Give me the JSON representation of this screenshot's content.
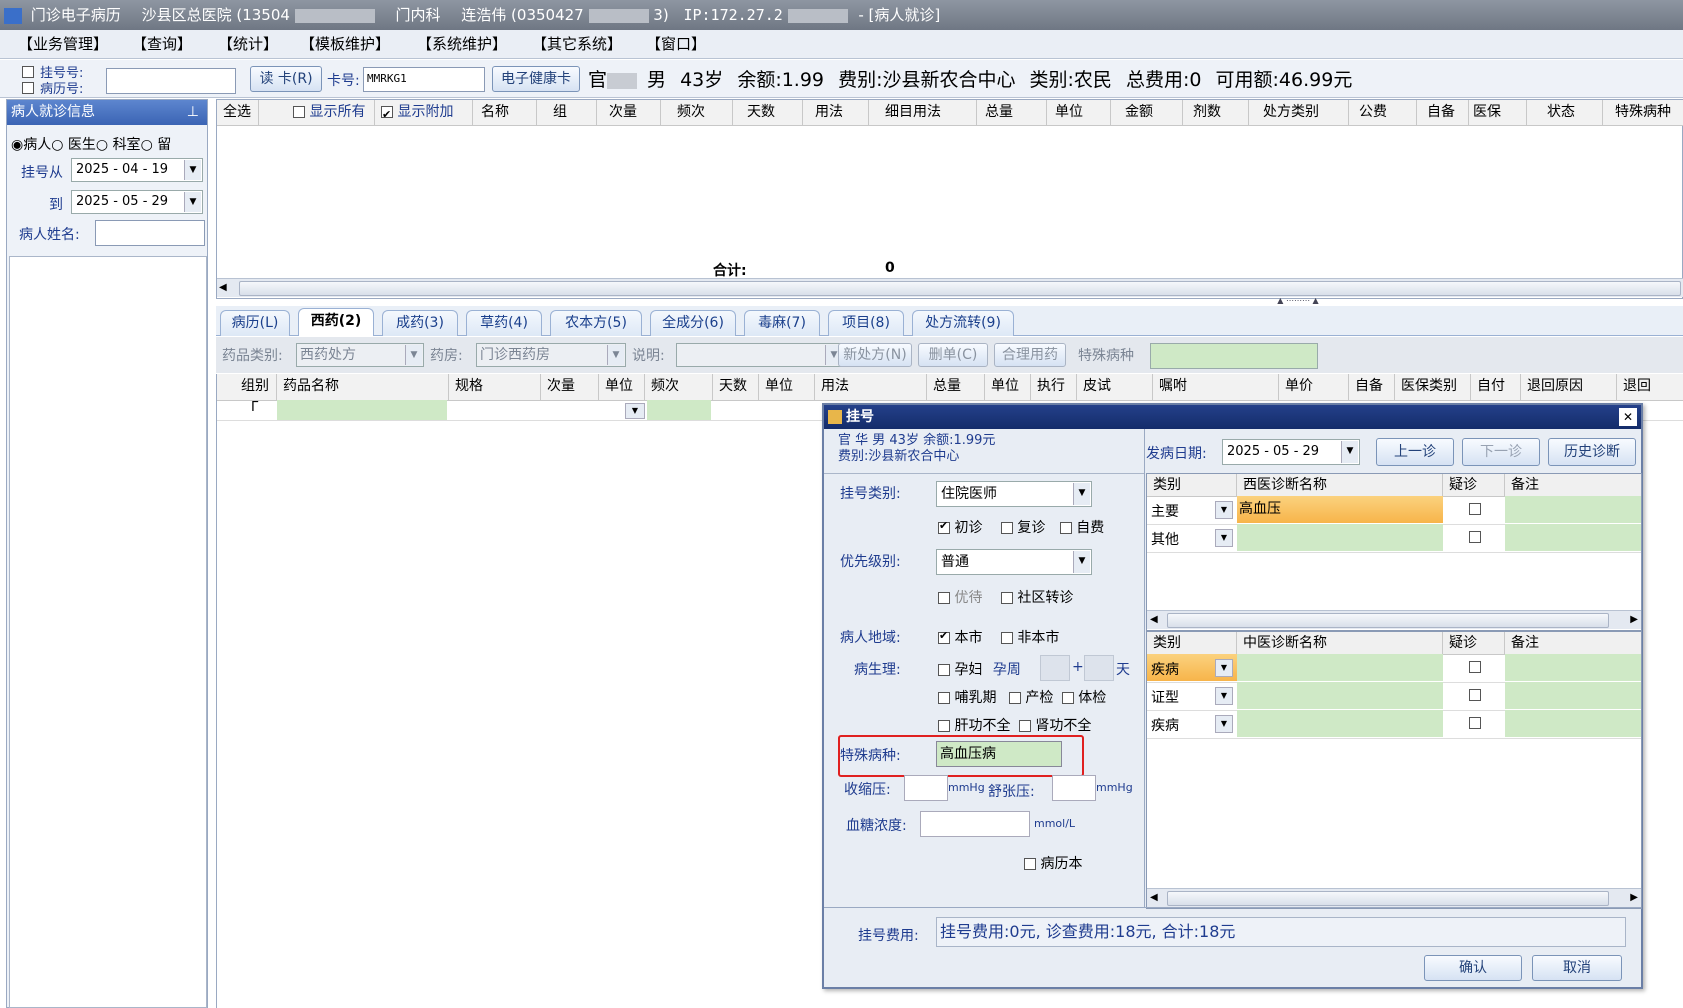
{
  "titlebar": {
    "app": "门诊电子病历",
    "hospital": "沙县区总医院 (13504",
    "dept": "门内科",
    "doctor": "连浩伟 (0350427",
    "doctor_tail": "3)",
    "ip": "IP:172.27.2",
    "window": "- [病人就诊]"
  },
  "menu": [
    "【业务管理】",
    "【查询】",
    "【统计】",
    "【模板维护】",
    "【系统维护】",
    "【其它系统】",
    "【窗口】"
  ],
  "toolbar": {
    "reg_no_label": "挂号号:",
    "record_no_label": "病历号:",
    "read_card": "读 卡(R)",
    "card_no_label": "卡号:",
    "card_no_value": "MMRKG1",
    "health_card": "电子健康卡",
    "patient_info": "官",
    "patient_gender": "男",
    "patient_age": "43岁",
    "balance": "余额:1.99",
    "fee_type": "费别:沙县新农合中心",
    "category": "类别:农民",
    "total_fee": "总费用:0",
    "available": "可用额:46.99元"
  },
  "left_panel": {
    "title": "病人就诊信息",
    "pin": "ꟸ",
    "radios": [
      "病人",
      "医生",
      "科室",
      "留"
    ],
    "from_label": "挂号从",
    "from_date": "2025 - 04 - 19",
    "to_label": "到",
    "to_date": "2025 - 05 - 29",
    "name_label": "病人姓名:"
  },
  "top_grid": {
    "headers": [
      "全选",
      "显示所有",
      "显示附加",
      "名称",
      "组",
      "次量",
      "频次",
      "天数",
      "用法",
      "细目用法",
      "总量",
      "单位",
      "金额",
      "剂数",
      "处方类别",
      "公费",
      "自备",
      "医保",
      "状态",
      "特殊病种"
    ],
    "total_label": "合计:",
    "total_value": "0"
  },
  "tabs": [
    "病历(L)",
    "西药(2)",
    "成药(3)",
    "草药(4)",
    "农本方(5)",
    "全成分(6)",
    "毒麻(7)",
    "项目(8)",
    "处方流转(9)"
  ],
  "rx_toolbar": {
    "drug_type_label": "药品类别:",
    "drug_type_value": "西药处方",
    "pharmacy_label": "药房:",
    "pharmacy_value": "门诊西药房",
    "note_label": "说明:",
    "new_rx": "新处方(N)",
    "delete_rx": "删单(C)",
    "rational": "合理用药",
    "special_label": "特殊病种"
  },
  "rx_grid": {
    "headers": [
      "组别",
      "药品名称",
      "规格",
      "次量",
      "单位",
      "频次",
      "天数",
      "单位",
      "用法",
      "总量",
      "单位",
      "执行",
      "皮试",
      "嘱咐",
      "单价",
      "自备",
      "医保类别",
      "自付",
      "退回原因",
      "退回"
    ]
  },
  "dialog": {
    "title": "挂号",
    "close": "✕",
    "patient_line1": "官  华 男 43岁 余额:1.99元",
    "patient_line2": "费别:沙县新农合中心",
    "onset_label": "发病日期:",
    "onset_date": "2025 - 05 - 29",
    "prev_visit": "上一诊",
    "next_visit": "下一诊",
    "history": "历史诊断",
    "reg_type_label": "挂号类别:",
    "reg_type_value": "住院医师",
    "first_visit": "初诊",
    "revisit": "复诊",
    "self_pay": "自费",
    "priority_label": "优先级别:",
    "priority_value": "普通",
    "preferential": "优待",
    "community": "社区转诊",
    "region_label": "病人地域:",
    "local": "本市",
    "nonlocal": "非本市",
    "physio_label": "病生理:",
    "pregnant": "孕妇",
    "preg_week": "孕周",
    "plus": "+",
    "day": "天",
    "lactation": "哺乳期",
    "prenatal": "产检",
    "checkup": "体检",
    "liver": "肝功不全",
    "kidney": "肾功不全",
    "special_label": "特殊病种:",
    "special_value": "高血压病",
    "systolic_label": "收缩压:",
    "diastolic_label": "舒张压:",
    "mmhg": "mmHg",
    "glucose_label": "血糖浓度:",
    "mmol": "mmol/L",
    "record_book": "病历本",
    "west_headers": [
      "类别",
      "西医诊断名称",
      "疑诊",
      "备注"
    ],
    "west_rows": [
      {
        "cat": "主要",
        "name": "高血压"
      },
      {
        "cat": "其他",
        "name": ""
      }
    ],
    "tcm_headers": [
      "类别",
      "中医诊断名称",
      "疑诊",
      "备注"
    ],
    "tcm_rows": [
      {
        "cat": "疾病",
        "name": ""
      },
      {
        "cat": "证型",
        "name": ""
      },
      {
        "cat": "疾病",
        "name": ""
      }
    ],
    "fee_label": "挂号费用:",
    "fee_value": "挂号费用:0元, 诊查费用:18元, 合计:18元",
    "ok": "确认",
    "cancel": "取消"
  },
  "colors": {
    "accent": "#1f3c8f",
    "highlight_red": "#e02020",
    "orange": "#f7b44a",
    "green_cell": "#cfe9c6"
  }
}
